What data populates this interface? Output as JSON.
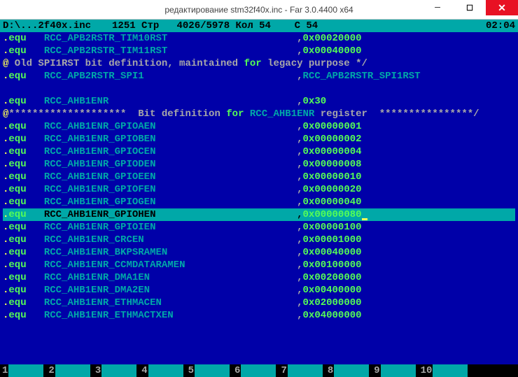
{
  "titlebar": {
    "title": "редактирование stm32f40x.inc - Far 3.0.4400 x64",
    "min": "─",
    "max": "☐",
    "close": "✕"
  },
  "status": {
    "path": "D:\\...2f40x.inc",
    "cp": "1251",
    "line_lbl": "Стр",
    "line": "4026/5978",
    "col_lbl": "Кол",
    "col": "54",
    "c_lbl": "С",
    "c_val": "54",
    "time": "02:04"
  },
  "lines": [
    {
      "type": "equ",
      "name": "RCC_APB2RSTR_TIM10RST",
      "val": "0x00020000"
    },
    {
      "type": "equ",
      "name": "RCC_APB2RSTR_TIM11RST",
      "val": "0x00040000"
    },
    {
      "type": "comment",
      "text": "@ Old SPI1RST bit definition, maintained for legacy purpose */"
    },
    {
      "type": "equ",
      "name": "RCC_APB2RSTR_SPI1",
      "val_ident": "RCC_APB2RSTR_SPI1RST"
    },
    {
      "type": "blank"
    },
    {
      "type": "equ",
      "name": "RCC_AHB1ENR",
      "val": "0x30"
    },
    {
      "type": "bitdef",
      "pre_stars": "********************",
      "mid": "  Bit definition for RCC_AHB1ENR register  ",
      "post_stars": "****************/"
    },
    {
      "type": "equ",
      "name": "RCC_AHB1ENR_GPIOAEN",
      "val": "0x00000001"
    },
    {
      "type": "equ",
      "name": "RCC_AHB1ENR_GPIOBEN",
      "val": "0x00000002"
    },
    {
      "type": "equ",
      "name": "RCC_AHB1ENR_GPIOCEN",
      "val": "0x00000004"
    },
    {
      "type": "equ",
      "name": "RCC_AHB1ENR_GPIODEN",
      "val": "0x00000008"
    },
    {
      "type": "equ",
      "name": "RCC_AHB1ENR_GPIOEEN",
      "val": "0x00000010"
    },
    {
      "type": "equ",
      "name": "RCC_AHB1ENR_GPIOFEN",
      "val": "0x00000020"
    },
    {
      "type": "equ",
      "name": "RCC_AHB1ENR_GPIOGEN",
      "val": "0x00000040"
    },
    {
      "type": "equ",
      "name": "RCC_AHB1ENR_GPIOHEN",
      "val": "0x00000080",
      "hl": true,
      "cursor": true
    },
    {
      "type": "equ",
      "name": "RCC_AHB1ENR_GPIOIEN",
      "val": "0x00000100"
    },
    {
      "type": "equ",
      "name": "RCC_AHB1ENR_CRCEN",
      "val": "0x00001000"
    },
    {
      "type": "equ",
      "name": "RCC_AHB1ENR_BKPSRAMEN",
      "val": "0x00040000"
    },
    {
      "type": "equ",
      "name": "RCC_AHB1ENR_CCMDATARAMEN",
      "val": "0x00100000"
    },
    {
      "type": "equ",
      "name": "RCC_AHB1ENR_DMA1EN",
      "val": "0x00200000"
    },
    {
      "type": "equ",
      "name": "RCC_AHB1ENR_DMA2EN",
      "val": "0x00400000"
    },
    {
      "type": "equ",
      "name": "RCC_AHB1ENR_ETHMACEN",
      "val": "0x02000000"
    },
    {
      "type": "equ",
      "name": "RCC_AHB1ENR_ETHMACTXEN",
      "val": "0x04000000"
    }
  ],
  "fkeys": [
    "1",
    "2",
    "3",
    "4",
    "5",
    "6",
    "7",
    "8",
    "9",
    "10"
  ],
  "fkey_labels": [
    "",
    "",
    "",
    "",
    "",
    "",
    "",
    "",
    "",
    ""
  ]
}
